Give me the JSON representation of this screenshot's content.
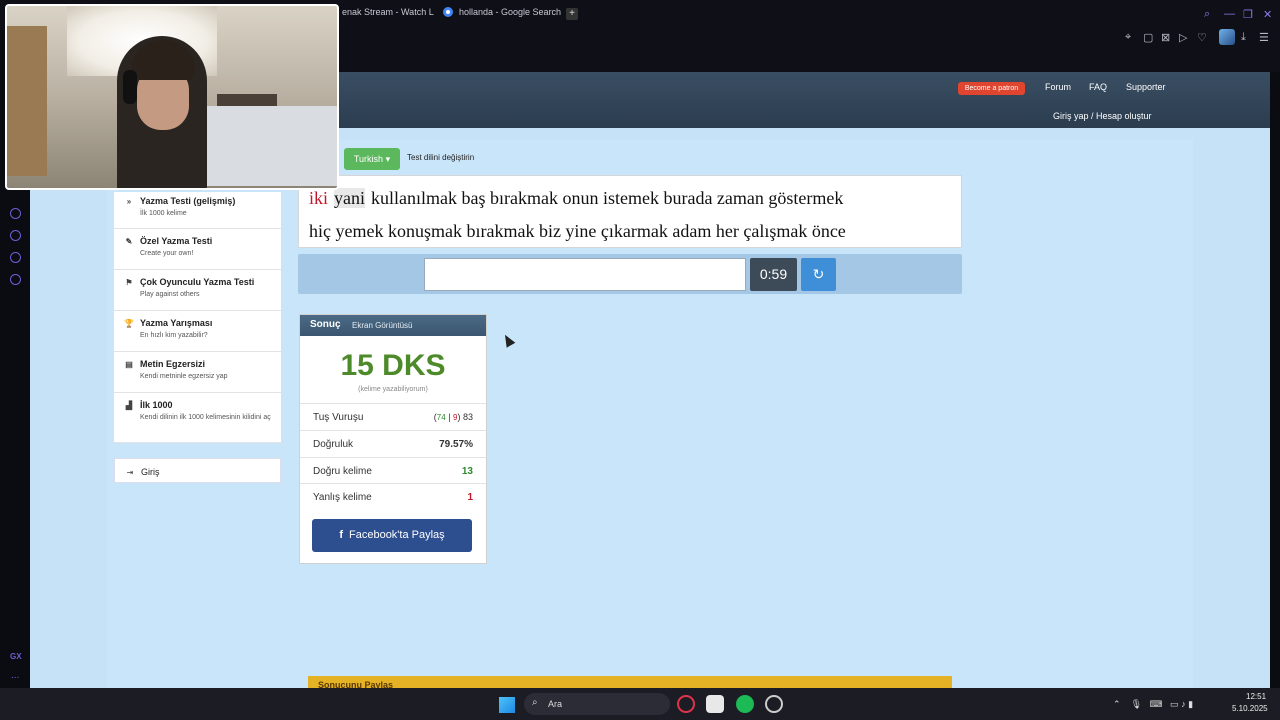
{
  "browser": {
    "tabs": [
      {
        "label": "enak Stream - Watch L"
      },
      {
        "label": "hollanda - Google Search"
      }
    ],
    "new_tab": "+",
    "sidebar_logo": "GX",
    "sidebar_more": "..."
  },
  "site": {
    "patron_label": "Become a patron",
    "nav": [
      "Forum",
      "FAQ",
      "Supporter"
    ],
    "login_link": "Giriş yap / Hesap oluştur"
  },
  "menu": [
    {
      "title": "Yazma Testi (gelişmiş)",
      "sub": "İlk 1000 kelime",
      "icon": "»"
    },
    {
      "title": "Özel Yazma Testi",
      "sub": "Create your own!",
      "icon": "✎"
    },
    {
      "title": "Çok Oyunculu Yazma Testi",
      "sub": "Play against others",
      "icon": "⚑"
    },
    {
      "title": "Yazma Yarışması",
      "sub": "En hızlı kim yazabilir?",
      "icon": "🏆"
    },
    {
      "title": "Metin Egzersizi",
      "sub": "Kendi metninle egzersiz yap",
      "icon": "▤"
    },
    {
      "title": "İlk 1000",
      "sub": "Kendi dilinin ilk 1000 kelimesinin kilidini aç",
      "icon": "▟"
    }
  ],
  "menu_login": "Giriş",
  "typing": {
    "language": "Turkish",
    "change_language": "Test dilini değiştirin",
    "current_word": "iki",
    "next_word": "yani",
    "line1_rest": "kullanılmak baş bırakmak onun istemek burada zaman göstermek",
    "line2": "hiç yemek konuşmak bırakmak biz yine çıkarmak adam her çalışmak önce",
    "input_value": "",
    "timer": "0:59"
  },
  "result": {
    "title": "Sonuç",
    "screenshot_label": "Ekran Görüntüsü",
    "wpm": "15 DKS",
    "wpm_sub": "(kelime yazabiliyorum)",
    "rows": {
      "keystrokes_label": "Tuş Vuruşu",
      "keystrokes_correct": "74",
      "keystrokes_wrong": "9",
      "keystrokes_total": "83",
      "accuracy_label": "Doğruluk",
      "accuracy_value": "79.57%",
      "correct_words_label": "Doğru kelime",
      "correct_words_value": "13",
      "wrong_words_label": "Yanlış kelime",
      "wrong_words_value": "1"
    },
    "facebook_share": "Facebook'ta Paylaş"
  },
  "share_bar": "Sonucunu Paylaş",
  "taskbar": {
    "search_label": "Ara",
    "time": "12:51",
    "date": "5.10.2025"
  },
  "colors": {
    "green_button": "#5cb85c",
    "wpm_green": "#4d8a2a",
    "error_red": "#c0182a",
    "facebook_blue": "#2d4f8f",
    "patron_red": "#e0452f"
  }
}
